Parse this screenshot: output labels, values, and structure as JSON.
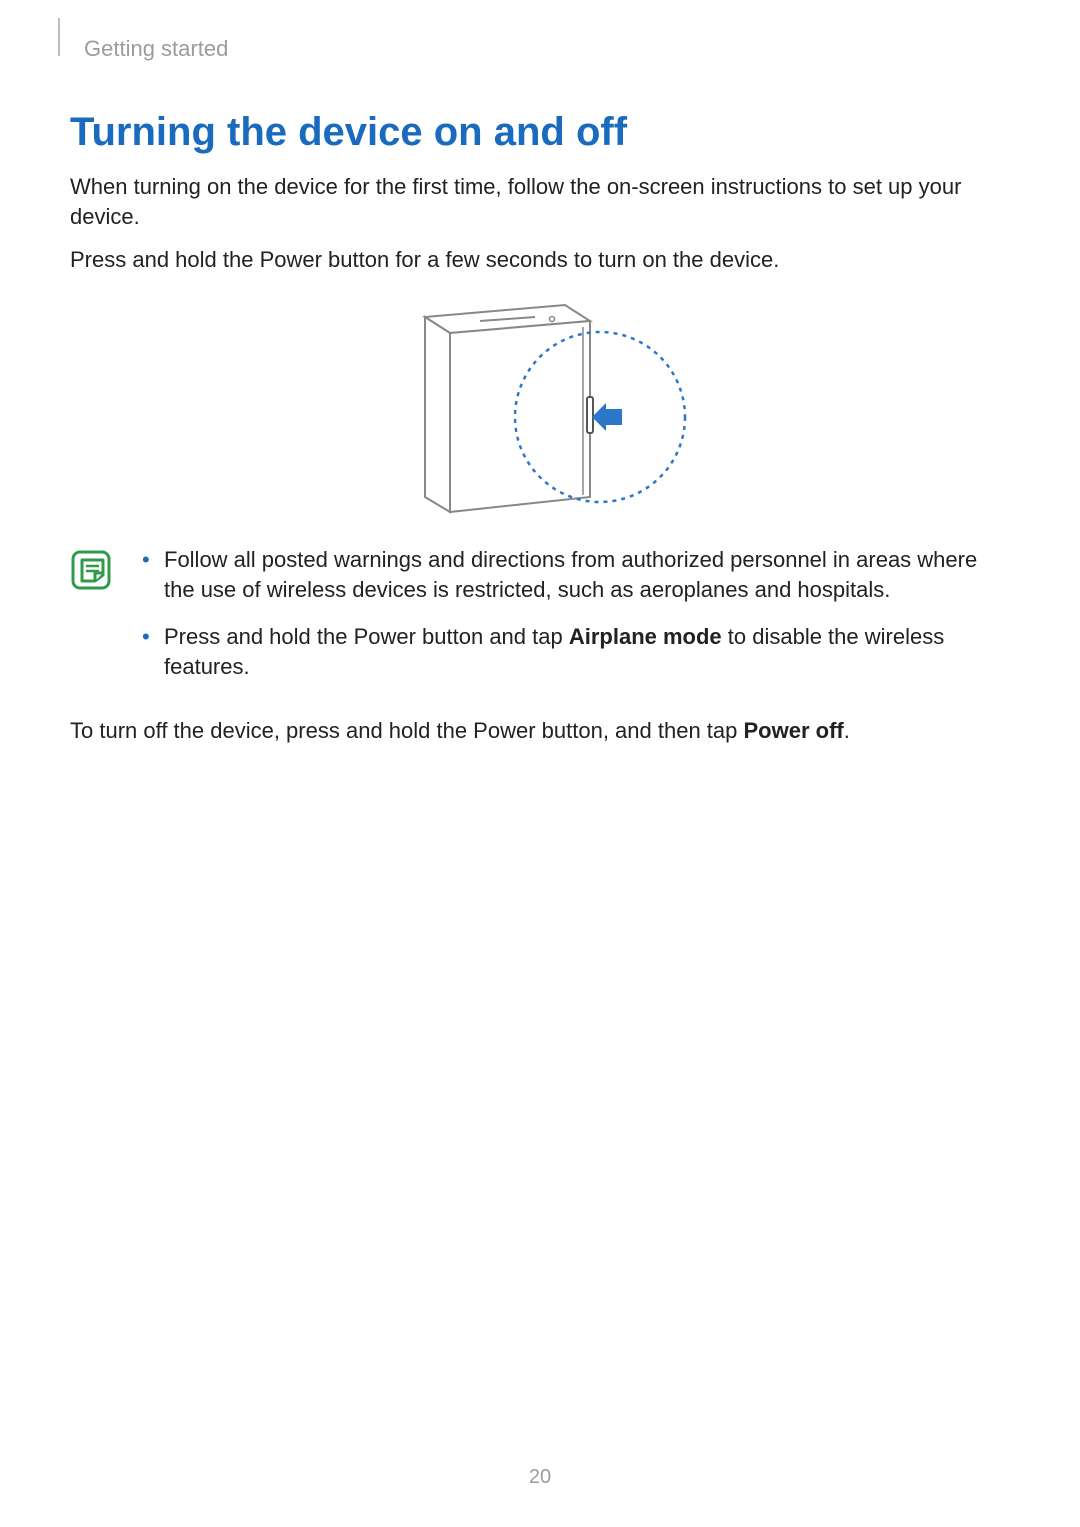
{
  "breadcrumb": "Getting started",
  "title": "Turning the device on and off",
  "para1": "When turning on the device for the first time, follow the on-screen instructions to set up your device.",
  "para2": "Press and hold the Power button for a few seconds to turn on the device.",
  "notes": {
    "item1": "Follow all posted warnings and directions from authorized personnel in areas where the use of wireless devices is restricted, such as aeroplanes and hospitals.",
    "item2_pre": "Press and hold the Power button and tap ",
    "item2_bold": "Airplane mode",
    "item2_post": " to disable the wireless features."
  },
  "para3_pre": "To turn off the device, press and hold the Power button, and then tap ",
  "para3_bold": "Power off",
  "para3_post": ".",
  "page_number": "20"
}
